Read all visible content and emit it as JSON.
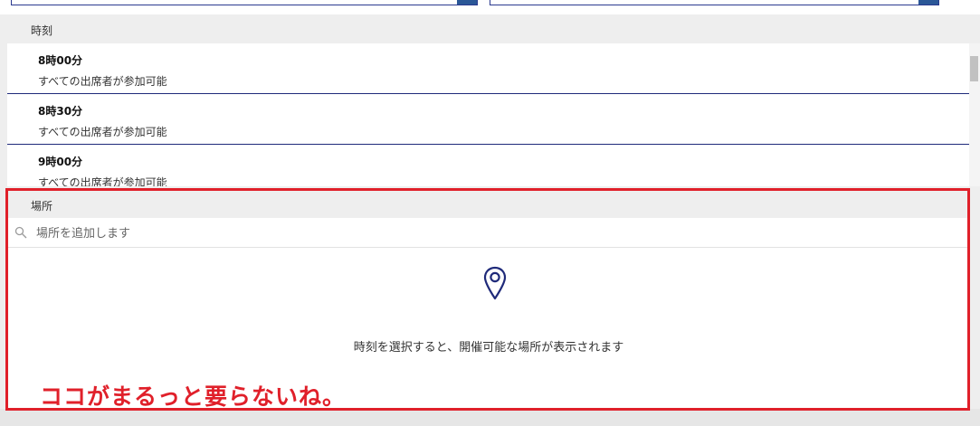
{
  "time_section": {
    "header": "時刻",
    "slots": [
      {
        "time": "8時00分",
        "status": "すべての出席者が参加可能"
      },
      {
        "time": "8時30分",
        "status": "すべての出席者が参加可能"
      },
      {
        "time": "9時00分",
        "status": "すべての出席者が参加可能"
      }
    ]
  },
  "location_section": {
    "header": "場所",
    "search_placeholder": "場所を追加します",
    "search_value": "",
    "empty_message": "時刻を選択すると、開催可能な場所が表示されます"
  },
  "annotation": {
    "text": "ココがまるっと要らないね。",
    "color": "#e0202a"
  },
  "colors": {
    "accent_navy": "#1f2a7a",
    "dropdown_button": "#2b5797",
    "annotation_red": "#e0202a"
  },
  "icons": {
    "search": "search-icon",
    "location": "location-pin-icon"
  }
}
